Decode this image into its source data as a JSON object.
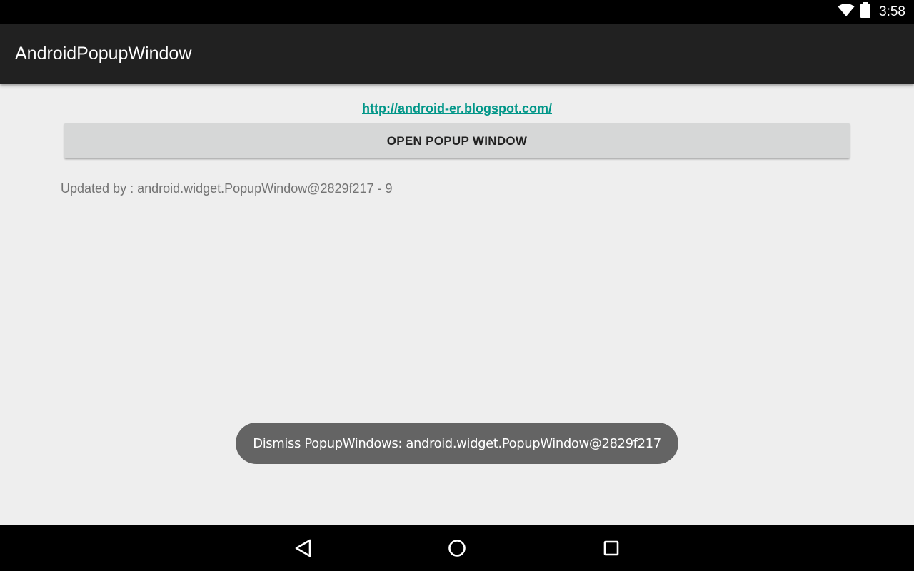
{
  "status_bar": {
    "time": "3:58",
    "icons": [
      "wifi-icon",
      "battery-icon"
    ]
  },
  "action_bar": {
    "title": "AndroidPopupWindow"
  },
  "content": {
    "link_text": "http://android-er.blogspot.com/",
    "open_button_label": "OPEN POPUP WINDOW",
    "updated_text": "Updated by : android.widget.PopupWindow@2829f217 - 9"
  },
  "toast": {
    "message": "Dismiss PopupWindows: android.widget.PopupWindow@2829f217"
  },
  "nav_bar": {
    "buttons": [
      "back-icon",
      "home-icon",
      "recents-icon"
    ]
  },
  "colors": {
    "status_bar": "#000000",
    "action_bar": "#212121",
    "background": "#eeeeee",
    "link": "#009688",
    "button": "#d6d7d7",
    "toast": "#646464",
    "nav_bar": "#000000"
  }
}
